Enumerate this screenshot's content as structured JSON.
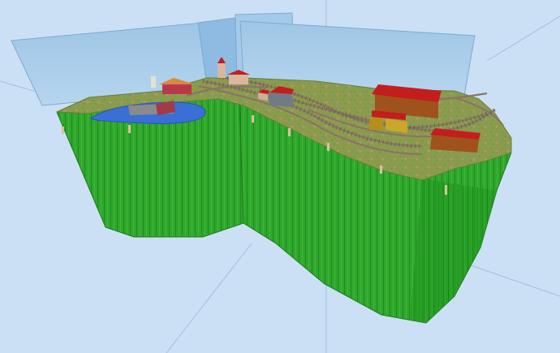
{
  "viewport": {
    "background_color": "#cbe0f4",
    "grid_color": "#8fb3d6"
  },
  "model": {
    "kind": "model railway layout (3D view)",
    "backdrop_color": "#a9cce8",
    "side_color": "#2fa82c",
    "top_color": "#8f9a4c",
    "track_color": "#8a7466",
    "water_color": "#3a6fd6",
    "roof_color": "#c41d1d",
    "wall_color": "#b05a2a"
  },
  "buildings": [
    {
      "name": "station-building-main",
      "roof": "#c41d1d",
      "wall": "#a0521d"
    },
    {
      "name": "goods-shed",
      "roof": "#c41d1d",
      "wall": "#a0521d"
    },
    {
      "name": "yellow-shed",
      "roof": "#c8a72a",
      "wall": "#b58f1c"
    },
    {
      "name": "village-house-gray",
      "roof": "#c41d1d",
      "wall": "#6f7c86"
    },
    {
      "name": "village-house-small",
      "roof": "#c41d1d",
      "wall": "#c9b19a"
    },
    {
      "name": "church",
      "roof": "#c41d1d",
      "wall": "#d7b7a0"
    },
    {
      "name": "lakeside-building",
      "roof": "#8b8b8b",
      "wall": "#a33a4a"
    },
    {
      "name": "farm-building",
      "roof": "#d88a3a",
      "wall": "#b83a4a"
    }
  ]
}
